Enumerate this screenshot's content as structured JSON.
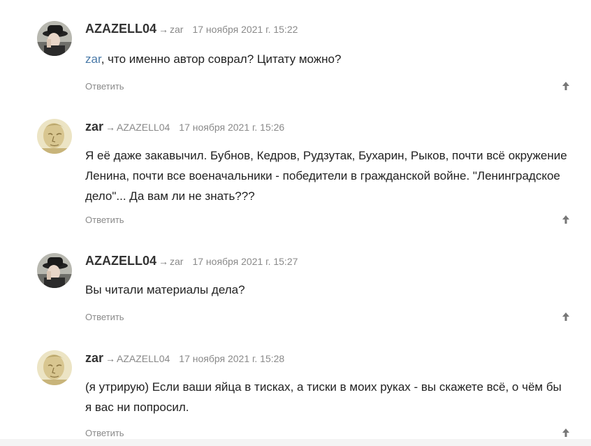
{
  "comments": [
    {
      "author": "AZAZELL04",
      "arrow": "→",
      "reply_to": "zar",
      "date": "17 ноября 2021 г. 15:22",
      "mention": "zar",
      "text": ", что именно автор соврал? Цитату можно?",
      "reply_label": "Ответить",
      "avatar": "fedora-man-avatar"
    },
    {
      "author": "zar",
      "arrow": "→",
      "reply_to": "AZAZELL04",
      "date": "17 ноября 2021 г. 15:26",
      "text": "Я её даже закавычил. Бубнов, Кедров, Рудзутак, Бухарин, Рыков, почти всё окружение Ленина, почти все военачальники - победители в гражданской войне. \"Ленинградское дело\"... Да вам ли не знать???",
      "reply_label": "Ответить",
      "avatar": "sketch-portrait-avatar"
    },
    {
      "author": "AZAZELL04",
      "arrow": "→",
      "reply_to": "zar",
      "date": "17 ноября 2021 г. 15:27",
      "text": "Вы читали материалы дела?",
      "reply_label": "Ответить",
      "avatar": "fedora-man-avatar"
    },
    {
      "author": "zar",
      "arrow": "→",
      "reply_to": "AZAZELL04",
      "date": "17 ноября 2021 г. 15:28",
      "text": "(я утрирую) Если ваши яйца в тисках, а тиски в моих руках - вы скажете всё, о чём бы я вас ни попросил.",
      "reply_label": "Ответить",
      "avatar": "sketch-portrait-avatar"
    }
  ],
  "icons": {
    "upvote": "arrow-up-icon"
  },
  "colors": {
    "mention": "#4a7aa8",
    "meta": "#8a8a8a",
    "text": "#222222"
  }
}
